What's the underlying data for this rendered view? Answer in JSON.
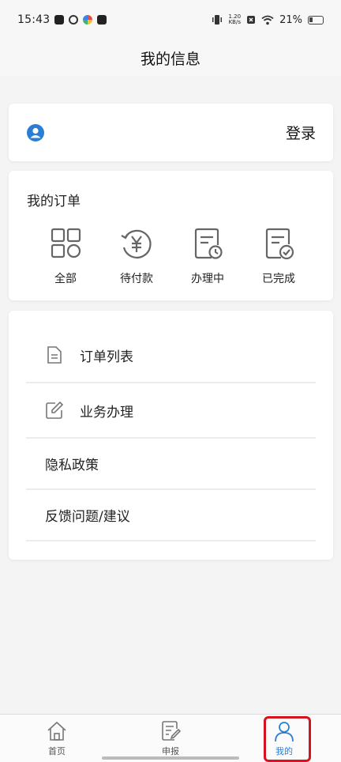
{
  "status_bar": {
    "time": "15:43",
    "net_speed_value": "1.20",
    "net_speed_unit": "KB/s",
    "battery": "21%"
  },
  "header": {
    "title": "我的信息"
  },
  "login": {
    "button_label": "登录"
  },
  "orders": {
    "title": "我的订单",
    "items": [
      {
        "label": "全部",
        "icon": "grid-icon"
      },
      {
        "label": "待付款",
        "icon": "yen-refresh-icon"
      },
      {
        "label": "办理中",
        "icon": "document-clock-icon"
      },
      {
        "label": "已完成",
        "icon": "document-check-icon"
      }
    ]
  },
  "menu": {
    "items": [
      {
        "label": "订单列表",
        "icon": "document-icon"
      },
      {
        "label": "业务办理",
        "icon": "edit-icon"
      },
      {
        "label": "隐私政策"
      },
      {
        "label": "反馈问题/建议"
      }
    ]
  },
  "bottom_nav": {
    "items": [
      {
        "label": "首页",
        "icon": "home-icon"
      },
      {
        "label": "申报",
        "icon": "report-icon"
      },
      {
        "label": "我的",
        "icon": "person-icon",
        "active": true
      }
    ]
  },
  "colors": {
    "accent": "#2a7fd4",
    "highlight": "#d6141f",
    "background": "#f4f4f4"
  }
}
